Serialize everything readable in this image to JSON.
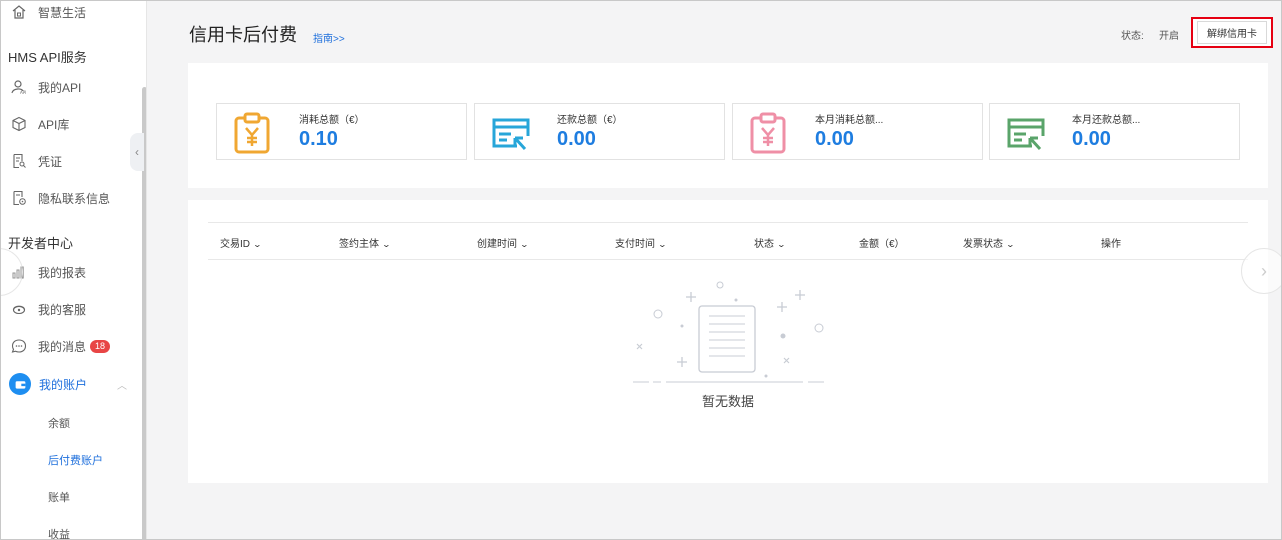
{
  "sidebar": {
    "top_item": {
      "label": "智慧生活",
      "icon": "home-icon"
    },
    "section_hms": "HMS API服务",
    "hms_items": [
      {
        "label": "我的API",
        "icon": "api-user-icon"
      },
      {
        "label": "API库",
        "icon": "cube-icon"
      },
      {
        "label": "凭证",
        "icon": "document-key-icon"
      },
      {
        "label": "隐私联系信息",
        "icon": "privacy-doc-icon"
      }
    ],
    "section_dev": "开发者中心",
    "dev_items": [
      {
        "label": "我的报表",
        "icon": "bar-chart-icon"
      },
      {
        "label": "我的客服",
        "icon": "headset-icon"
      },
      {
        "label": "我的消息",
        "icon": "chat-bubble-icon",
        "badge": "18"
      }
    ],
    "account": {
      "label": "我的账户",
      "icon": "wallet-icon"
    },
    "account_subs": [
      {
        "label": "余额",
        "active": false
      },
      {
        "label": "后付费账户",
        "active": true
      },
      {
        "label": "账单",
        "active": false
      },
      {
        "label": "收益",
        "active": false
      }
    ]
  },
  "header": {
    "title": "信用卡后付费",
    "guide_link": "指南>>",
    "status_label": "状态:",
    "status_value": "开启",
    "unbind_button": "解绑信用卡"
  },
  "summary_cards": [
    {
      "label": "消耗总额（€）",
      "value": "0.10",
      "icon": "clipboard-yen-icon",
      "color": "#f0a732"
    },
    {
      "label": "还款总额（€）",
      "value": "0.00",
      "icon": "card-return-icon",
      "color": "#27a6d9"
    },
    {
      "label": "本月消耗总额...",
      "value": "0.00",
      "icon": "clipboard-yen-icon",
      "color": "#ef8fa6"
    },
    {
      "label": "本月还款总额...",
      "value": "0.00",
      "icon": "card-return-icon",
      "color": "#5aa46a"
    }
  ],
  "table": {
    "columns": [
      {
        "label": "交易ID",
        "sortable": true
      },
      {
        "label": "签约主体",
        "sortable": true
      },
      {
        "label": "创建时间",
        "sortable": true
      },
      {
        "label": "支付时间",
        "sortable": true
      },
      {
        "label": "状态",
        "sortable": true
      },
      {
        "label": "金额（€）",
        "sortable": false
      },
      {
        "label": "发票状态",
        "sortable": true
      },
      {
        "label": "操作",
        "sortable": false
      }
    ],
    "rows": [],
    "empty_text": "暂无数据"
  },
  "colors": {
    "accent": "#1e6fdc",
    "value_blue": "#1e7de0",
    "highlight_red": "#e60012"
  }
}
